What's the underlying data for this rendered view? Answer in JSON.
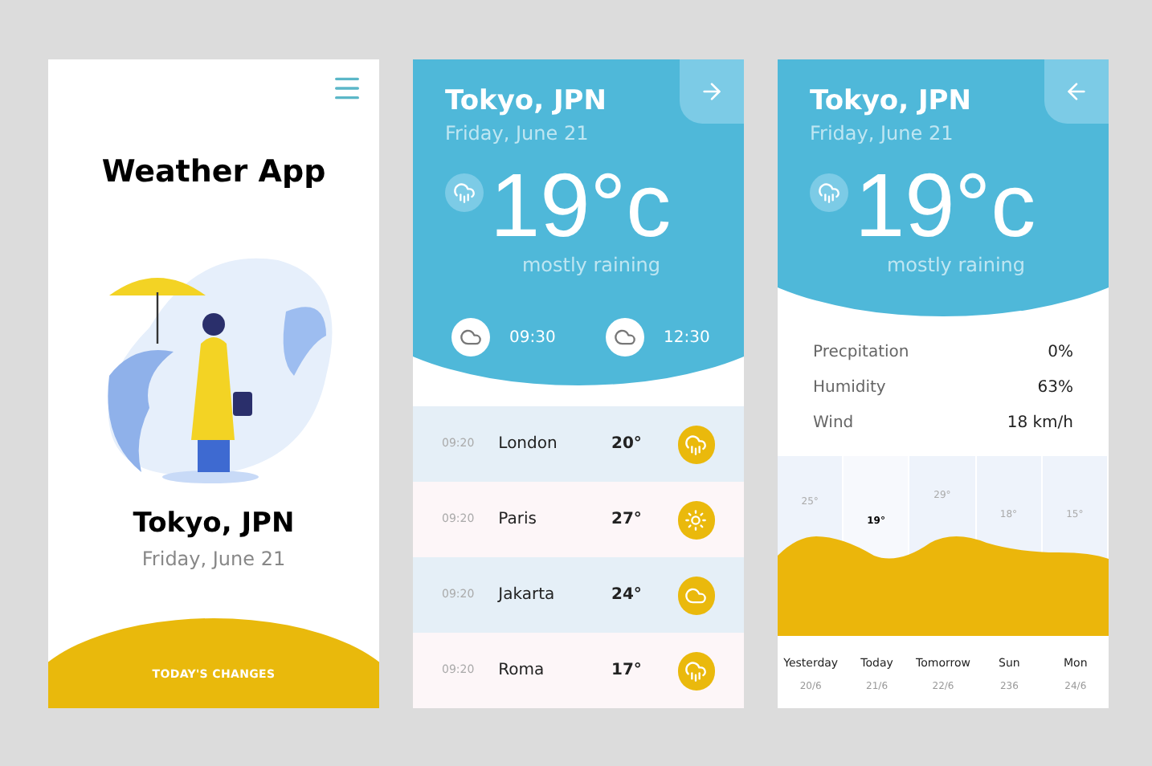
{
  "intro": {
    "title": "Weather App",
    "city": "Tokyo, JPN",
    "date": "Friday, June 21",
    "button": "TODAY'S CHANGES"
  },
  "today": {
    "city": "Tokyo, JPN",
    "date": "Friday, June 21",
    "temperature": "19°c",
    "condition": "mostly raining",
    "times": [
      {
        "time": "09:30"
      },
      {
        "time": "12:30"
      }
    ],
    "cities": [
      {
        "time": "09:20",
        "name": "London",
        "temp": "20°",
        "kind": "rain"
      },
      {
        "time": "09:20",
        "name": "Paris",
        "temp": "27°",
        "kind": "sun"
      },
      {
        "time": "09:20",
        "name": "Jakarta",
        "temp": "24°",
        "kind": "cloud"
      },
      {
        "time": "09:20",
        "name": "Roma",
        "temp": "17°",
        "kind": "rain"
      }
    ]
  },
  "details": {
    "city": "Tokyo, JPN",
    "date": "Friday, June 21",
    "temperature": "19°c",
    "condition": "mostly raining",
    "stats": [
      {
        "label": "Precpitation",
        "value": "0%"
      },
      {
        "label": "Humidity",
        "value": "63%"
      },
      {
        "label": "Wind",
        "value": "18 km/h"
      }
    ],
    "forecast": [
      {
        "temp": "25°",
        "day": "Yesterday",
        "date": "20/6",
        "selected": false
      },
      {
        "temp": "19°",
        "day": "Today",
        "date": "21/6",
        "selected": true
      },
      {
        "temp": "29°",
        "day": "Tomorrow",
        "date": "22/6",
        "selected": false
      },
      {
        "temp": "18°",
        "day": "Sun",
        "date": "236",
        "selected": false
      },
      {
        "temp": "15°",
        "day": "Mon",
        "date": "24/6",
        "selected": false
      }
    ]
  }
}
